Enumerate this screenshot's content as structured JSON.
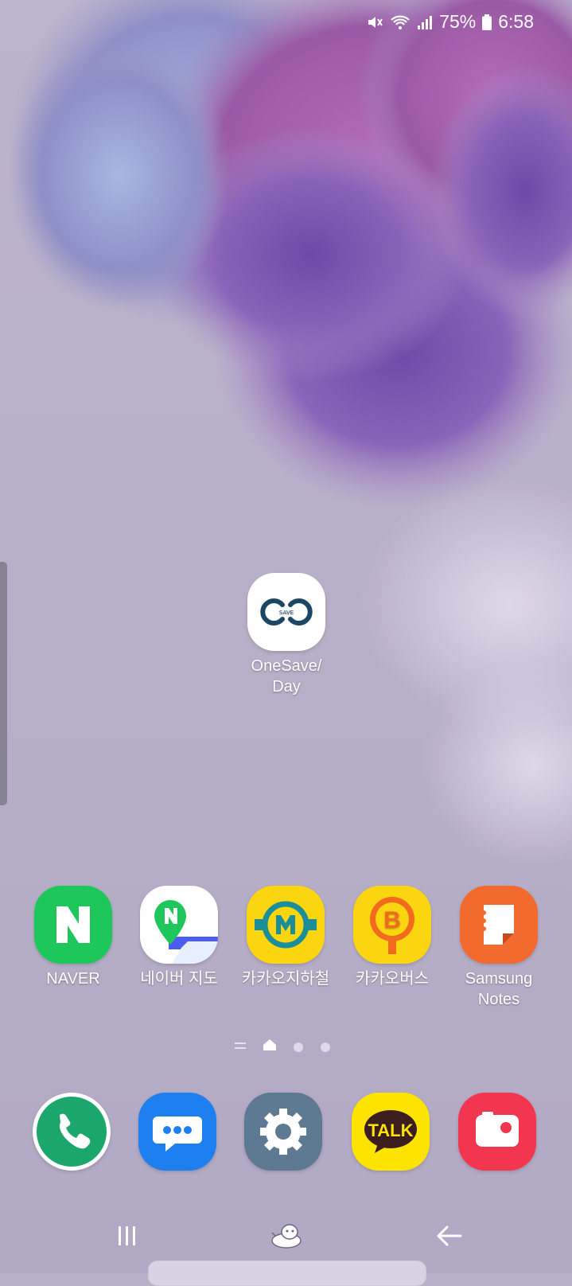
{
  "status_bar": {
    "battery_percent": "75%",
    "time": "6:58",
    "icons": [
      "mute-icon",
      "wifi-icon",
      "signal-icon",
      "battery-icon"
    ]
  },
  "home_apps": [
    {
      "label": "OneSave/\nDay",
      "icon": "onesave-icon"
    }
  ],
  "app_row": [
    {
      "label": "NAVER",
      "icon": "naver-icon",
      "color": "#1ec800"
    },
    {
      "label": "네이버 지도",
      "icon": "naver-map-icon",
      "color": "#ffffff"
    },
    {
      "label": "카카오지하철",
      "icon": "kakao-metro-icon",
      "color": "#fcd511"
    },
    {
      "label": "카카오버스",
      "icon": "kakao-bus-icon",
      "color": "#fcd511"
    },
    {
      "label": "Samsung\nNotes",
      "icon": "samsung-notes-icon",
      "color": "#f26a2e"
    }
  ],
  "dock": [
    {
      "name": "phone",
      "icon": "phone-icon",
      "color": "#1ba66b"
    },
    {
      "name": "messages",
      "icon": "messages-icon",
      "color": "#1e7ff0"
    },
    {
      "name": "settings",
      "icon": "settings-icon",
      "color": "#5d7a92"
    },
    {
      "name": "kakaotalk",
      "icon": "kakaotalk-icon",
      "color": "#fce300"
    },
    {
      "name": "camera",
      "icon": "camera-icon",
      "color": "#f2364f"
    }
  ],
  "kakaotalk_text": "TALK",
  "page_indicator": {
    "pages": 3,
    "current_page": 1
  },
  "nav_bar": {
    "buttons": [
      "recents-button",
      "home-button",
      "back-button"
    ]
  }
}
